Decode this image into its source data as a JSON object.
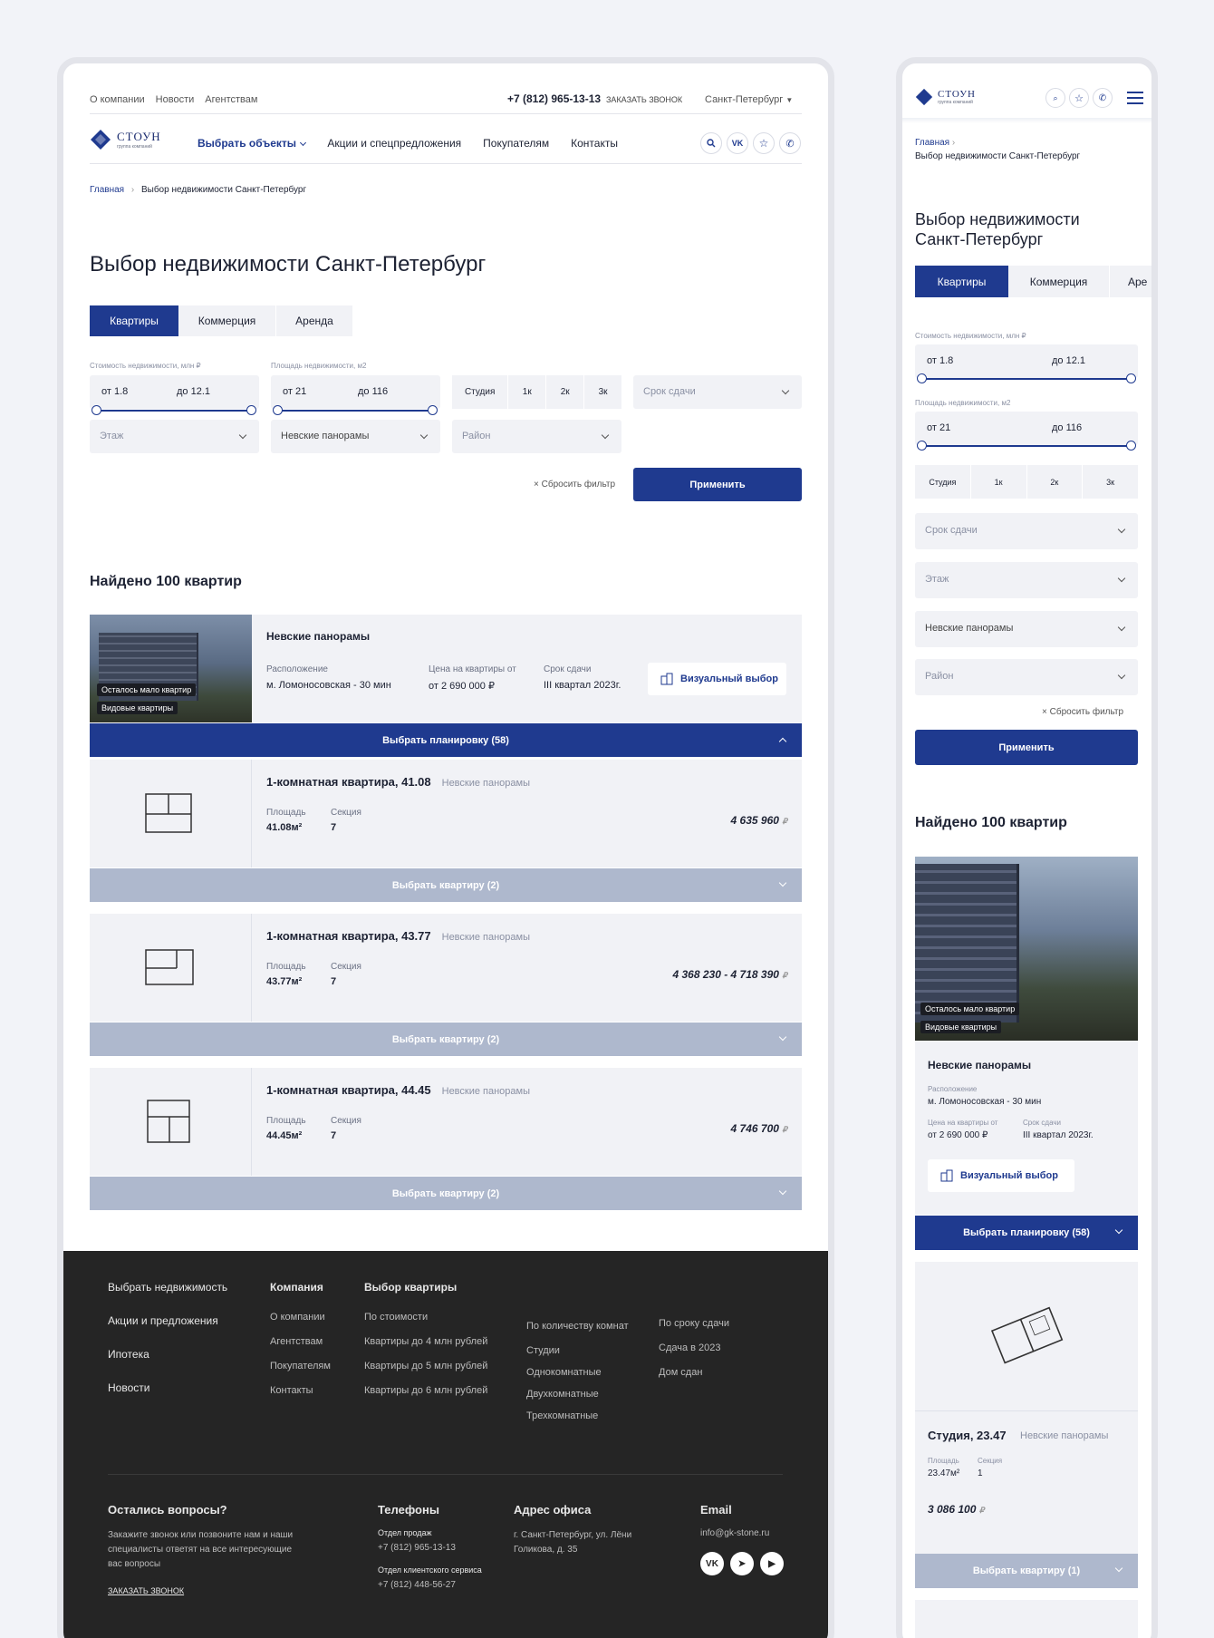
{
  "header": {
    "links": [
      "О компании",
      "Новости",
      "Агентствам"
    ],
    "phone": "+7 (812) 965-13-13",
    "callback": "ЗАКАЗАТЬ ЗВОНОК",
    "city": "Санкт-Петербург",
    "logo": "СТОУН",
    "logo_sub": "группа компаний",
    "nav": [
      "Выбрать объекты",
      "Акции и спецпредложения",
      "Покупателям",
      "Контакты"
    ]
  },
  "breadcrumb": {
    "home": "Главная",
    "current": "Выбор недвижимости Санкт-Петербург"
  },
  "page_title": "Выбор недвижимости Санкт-Петербург",
  "tabs": [
    "Квартиры",
    "Коммерция",
    "Аренда"
  ],
  "filters": {
    "price_label": "Стоимость недвижимости, млн ₽",
    "price_from": "от 1.8",
    "price_to": "до 12.1",
    "area_label": "Площадь недвижимости, м2",
    "area_from": "от 21",
    "area_to": "до 116",
    "rooms": [
      "Студия",
      "1к",
      "2к",
      "3к"
    ],
    "deadline": "Срок сдачи",
    "floor": "Этаж",
    "complex": "Невские панорамы",
    "district": "Район",
    "reset": "Сбросить фильтр",
    "apply": "Применить"
  },
  "results_title": "Найдено 100 квартир",
  "complex": {
    "name": "Невские панорамы",
    "loc_label": "Расположение",
    "loc": "м. Ломоносовская - 30 мин",
    "price_label": "Цена на квартиры от",
    "price": "от 2 690 000 ₽",
    "term_label": "Срок сдачи",
    "term": "III квартал 2023г.",
    "visual": "Визуальный выбор",
    "tag1": "Осталось мало квартир",
    "tag2": "Видовые квартиры",
    "choose_plan": "Выбрать планировку (58)"
  },
  "flats": [
    {
      "title": "1-комнатная квартира, 41.08",
      "complex": "Невские панорамы",
      "area_label": "Площадь",
      "area": "41.08м²",
      "sec_label": "Секция",
      "sec": "7",
      "price": "4 635 960",
      "btn": "Выбрать квартиру (2)"
    },
    {
      "title": "1-комнатная квартира, 43.77",
      "complex": "Невские панорамы",
      "area_label": "Площадь",
      "area": "43.77м²",
      "sec_label": "Секция",
      "sec": "7",
      "price": "4 368 230 - 4 718 390",
      "btn": "Выбрать квартиру (2)"
    },
    {
      "title": "1-комнатная квартира, 44.45",
      "complex": "Невские панорамы",
      "area_label": "Площадь",
      "area": "44.45м²",
      "sec_label": "Секция",
      "sec": "7",
      "price": "4 746 700",
      "btn": "Выбрать квартиру (2)"
    }
  ],
  "currency": "₽",
  "footer": {
    "col1": [
      "Выбрать недвижимость",
      "Акции и предложения",
      "Ипотека",
      "Новости"
    ],
    "company_title": "Компания",
    "company": [
      "О компании",
      "Агентствам",
      "Покупателям",
      "Контакты"
    ],
    "flats_title": "Выбор квартиры",
    "by_price": [
      "По стоимости",
      "Квартиры до 4 млн рублей",
      "Квартиры до 5 млн рублей",
      "Квартиры до 6 млн рублей"
    ],
    "by_rooms": [
      "По количеству комнат",
      "Студии",
      "Однокомнатные",
      "Двухкомнатные",
      "Трехкомнатные"
    ],
    "by_term": [
      "По сроку сдачи",
      "Сдача в 2023",
      "Дом сдан"
    ],
    "q_title": "Остались вопросы?",
    "q_text": "Закажите звонок или позвоните нам и наши специалисты ответят на все интересующие вас вопросы",
    "q_link": "ЗАКАЗАТЬ ЗВОНОК",
    "phones_title": "Телефоны",
    "sales_label": "Отдел продаж",
    "sales_phone": "+7 (812) 965-13-13",
    "service_label": "Отдел клиентского сервиса",
    "service_phone": "+7 (812) 448-56-27",
    "addr_title": "Адрес офиса",
    "addr": "г. Санкт-Петербург, ул. Лёни Голикова, д. 35",
    "email_title": "Email",
    "email": "info@gk-stone.ru",
    "social": [
      "vk",
      "telegram",
      "youtube"
    ]
  },
  "mobile": {
    "title": "Выбор недвижимости Санкт-Петербург",
    "tab3": "Аре",
    "studio": {
      "title": "Студия, 23.47",
      "complex": "Невские панорамы",
      "area": "23.47м²",
      "sec": "1",
      "price": "3 086 100",
      "btn": "Выбрать квартиру (1)"
    }
  },
  "colors": {
    "primary": "#1f3a8f",
    "footer": "#252525",
    "secondary_btn": "#aeb8cd"
  }
}
